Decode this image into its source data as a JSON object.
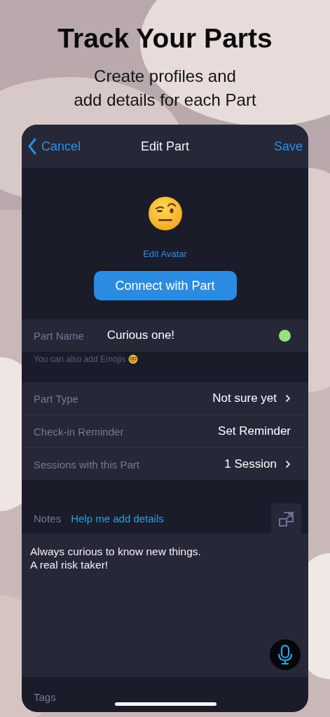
{
  "headline": "Track Your Parts",
  "subtitle": [
    "Create profiles and",
    "add details for each Part"
  ],
  "nav": {
    "back": "Cancel",
    "title": "Edit Part",
    "action": "Save"
  },
  "avatar": {
    "edit_label": "Edit Avatar",
    "connect_button": "Connect with Part"
  },
  "part_name": {
    "label": "Part Name",
    "value": "Curious one!",
    "color": "#9be07f",
    "hint": "You can also add Emojis"
  },
  "rows": [
    {
      "label": "Part Type",
      "value": "Not sure yet",
      "chevron": true
    },
    {
      "label": "Check-in Reminder",
      "value": "Set Reminder",
      "chevron": false
    },
    {
      "label": "Sessions with this Part",
      "value": "1 Session",
      "chevron": true
    }
  ],
  "notes": {
    "label": "Notes",
    "helper_link": "Help me add details",
    "text": [
      "Always curious to know new things.",
      "A real risk taker!"
    ]
  },
  "tags": {
    "label": "Tags"
  }
}
